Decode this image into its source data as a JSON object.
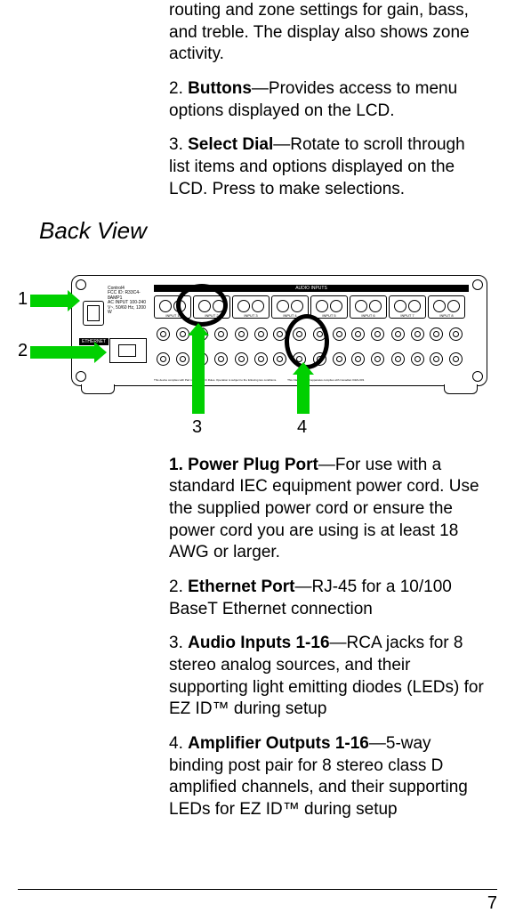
{
  "top_items": [
    {
      "prefix": "",
      "bold": "",
      "text": "routing and zone settings for gain, bass, and treble. The display also shows zone activity."
    },
    {
      "prefix": "2.  ",
      "bold": "Buttons",
      "text": "—Provides access to menu options displayed on the LCD."
    },
    {
      "prefix": "3.  ",
      "bold": "Select Dial",
      "text": "—Rotate to scroll through list items and options displayed on the LCD. Press to make selections."
    }
  ],
  "section_title": "Back View",
  "figure": {
    "callouts": [
      "1",
      "2",
      "3",
      "4"
    ],
    "panel_labels": {
      "brand": "Control4",
      "model": "FCC ID: R33C4-8AMP1",
      "power": "AC INPUT 100-240 V~, 50/60 Hz, 1200 W",
      "ethernet": "ETHERNET",
      "audio": "AUDIO INPUTS",
      "input_prefix": "INPUT",
      "fine1": "This device complies with Part 15 of the FCC Rules. Operation is subject to the following two conditions.",
      "fine2": "This Class B digital apparatus complies with Canadian ICES-003."
    }
  },
  "back_items": [
    {
      "prefix": "1.  ",
      "bold": "Power Plug Port",
      "text": "—For use with a standard IEC equipment power cord. Use the supplied power cord or ensure the power cord you are using is at least 18 AWG or larger."
    },
    {
      "prefix": "2.  ",
      "bold": "Ethernet Port",
      "text": "—RJ-45 for a 10/100 BaseT Ethernet connection"
    },
    {
      "prefix": "3.  ",
      "bold": "Audio Inputs 1-16",
      "text": "—RCA jacks for 8 stereo analog sources, and their supporting light emitting diodes (LEDs) for EZ ID™ during setup"
    },
    {
      "prefix": "4.  ",
      "bold": "Amplifier Outputs 1-16",
      "text": "—5-way binding post pair for 8 stereo class D amplified channels, and their supporting LEDs for EZ ID™ during setup"
    }
  ],
  "page_number": "7"
}
